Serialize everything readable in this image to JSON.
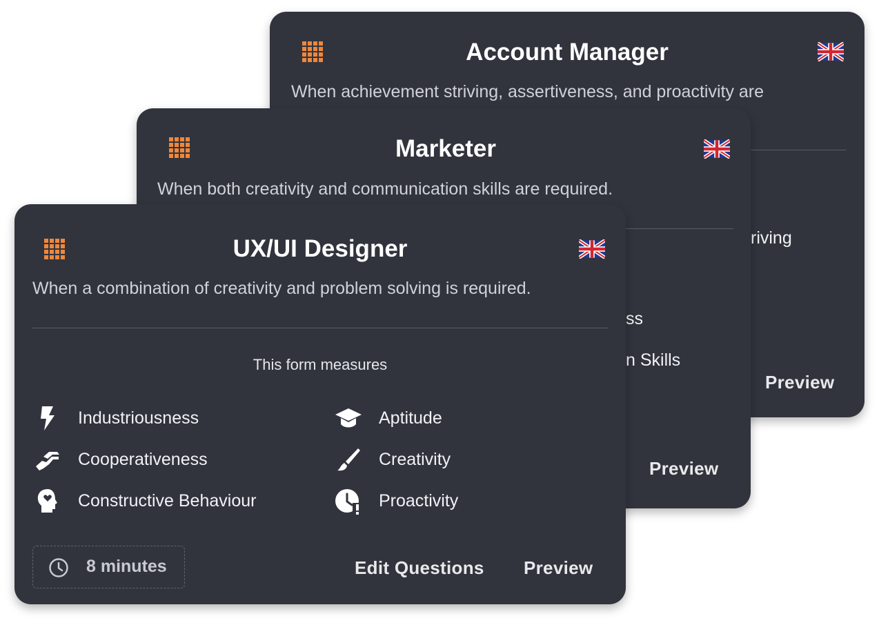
{
  "cards": {
    "back": {
      "title": "Account Manager",
      "description": "When achievement striving, assertiveness, and proactivity are",
      "partial_measure": "riving",
      "preview_label": "Preview"
    },
    "mid": {
      "title": "Marketer",
      "description": "When both creativity and communication skills are required.",
      "partial_measure_1": "ss",
      "partial_measure_2": "n Skills",
      "preview_label": "Preview"
    },
    "front": {
      "title": "UX/UI Designer",
      "description": "When a combination of creativity and problem solving is required.",
      "measures_heading": "This form measures",
      "measures": [
        {
          "label": "Industriousness",
          "icon": "lightning-icon"
        },
        {
          "label": "Aptitude",
          "icon": "graduation-cap-icon"
        },
        {
          "label": "Cooperativeness",
          "icon": "handshake-icon"
        },
        {
          "label": "Creativity",
          "icon": "paintbrush-icon"
        },
        {
          "label": "Constructive Behaviour",
          "icon": "head-heart-icon"
        },
        {
          "label": "Proactivity",
          "icon": "clock-alert-icon"
        }
      ],
      "duration": "8 minutes",
      "edit_label": "Edit Questions",
      "preview_label": "Preview"
    }
  },
  "colors": {
    "card_bg": "#31343d",
    "accent": "#f0873a"
  },
  "icons": {
    "grid": "grid-icon",
    "flag": "uk-flag-icon",
    "duration": "clock-icon"
  }
}
